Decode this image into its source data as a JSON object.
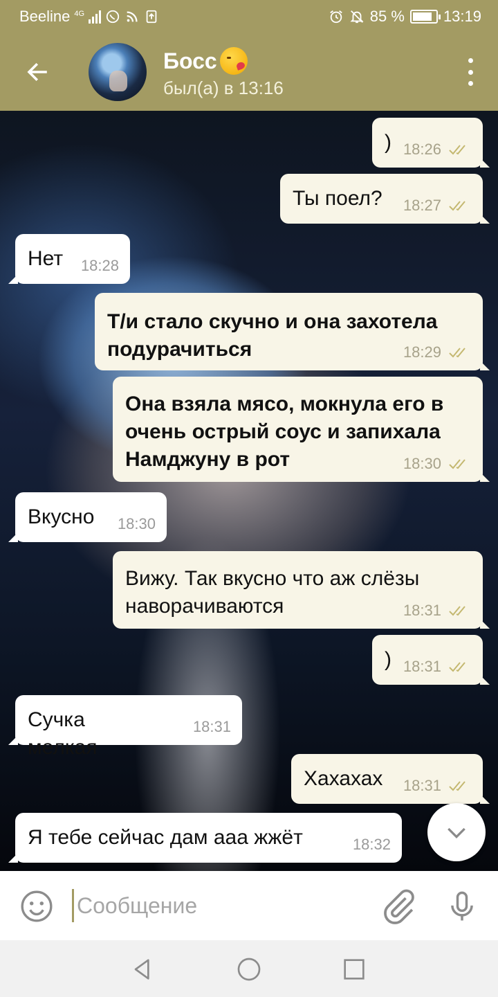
{
  "status_bar": {
    "carrier": "Beeline",
    "network": "4G",
    "battery": "85 %",
    "battery_level": 0.85,
    "time": "13:19"
  },
  "header": {
    "name": "Босс",
    "last_seen": "был(а) в 13:16"
  },
  "messages": [
    {
      "dir": "out",
      "text": ")",
      "time": "18:26",
      "read": true
    },
    {
      "dir": "out",
      "text": "Ты поел?",
      "time": "18:27",
      "read": true
    },
    {
      "dir": "in",
      "text": "Нет",
      "time": "18:28"
    },
    {
      "dir": "out",
      "text": "Т/и стало скучно и она захотела подурачиться",
      "time": "18:29",
      "read": true,
      "bold": true
    },
    {
      "dir": "out",
      "text": "Она взяла мясо, мокнула его в очень острый соус и запихала Намджуну в рот",
      "time": "18:30",
      "read": true,
      "bold": true
    },
    {
      "dir": "in",
      "text": "Вкусно",
      "time": "18:30"
    },
    {
      "dir": "out",
      "text": "Вижу. Так вкусно что аж слёзы наворачиваются",
      "time": "18:31",
      "read": true
    },
    {
      "dir": "out",
      "text": ")",
      "time": "18:31",
      "read": true
    },
    {
      "dir": "in",
      "text": "Сучка мелкая",
      "time": "18:31"
    },
    {
      "dir": "out",
      "text": "Хахахах",
      "time": "18:31",
      "read": true
    },
    {
      "dir": "in",
      "text": "Я тебе сейчас дам ааа жжёт",
      "time": "18:32"
    }
  ],
  "input": {
    "placeholder": "Сообщение",
    "value": ""
  },
  "colors": {
    "header": "#a39b63",
    "bubble_out": "#f8f5e7",
    "bubble_in": "#ffffff",
    "ticks": "#c4b870"
  },
  "icons": [
    "back-arrow-icon",
    "more-vert-icon",
    "emoji-icon",
    "attach-icon",
    "mic-icon",
    "chevron-down-icon",
    "nav-back-icon",
    "nav-home-icon",
    "nav-recents-icon"
  ]
}
